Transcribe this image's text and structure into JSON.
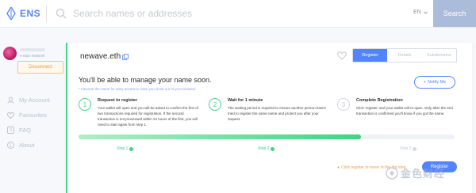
{
  "header": {
    "logo_text": "ENS",
    "search_placeholder": "Search names or addresses",
    "language": "EN",
    "search_button": "Search"
  },
  "sidebar": {
    "network": "Main Network",
    "disconnect_label": "Disconnect",
    "items": [
      {
        "label": "My Account",
        "icon": "user-icon"
      },
      {
        "label": "Favourites",
        "icon": "heart-icon"
      },
      {
        "label": "FAQ",
        "icon": "question-icon"
      },
      {
        "label": "About",
        "icon": "info-icon"
      }
    ]
  },
  "main": {
    "domain": "newave.eth",
    "tabs": [
      {
        "label": "Register",
        "active": true
      },
      {
        "label": "Details",
        "active": false
      },
      {
        "label": "Subdomains",
        "active": false
      }
    ],
    "headline": "You'll be able to manage your name soon.",
    "subnote": "* Favorite the name for easy access in case you close out of your browser.",
    "notify_label": "Notify Me",
    "steps": [
      {
        "number": "1",
        "title": "Request to register",
        "description": "Your wallet will open and you will be asked to confirm the first of two transactions required for registration. If the second transaction is not processed within 24 hours of the first, you will need to start again from step 1.",
        "label": "Step 1",
        "complete": true
      },
      {
        "number": "2",
        "title": "Wait for 1 minute",
        "description": "The waiting period is required to ensure another person hasn't tried to register the same name and protect you after your request.",
        "label": "Step 2",
        "complete": true
      },
      {
        "number": "3",
        "title": "Complete Registration",
        "description": "Click 'register' and your wallet will re-open. Only after the 2nd transaction is confirmed you'll know if you got the name.",
        "label": "Step 3",
        "complete": false
      }
    ],
    "progress_fraction": 0.75,
    "hint": "Click register to move to the 3rd step",
    "register_label": "Register"
  },
  "watermark": {
    "text": "金色财经"
  },
  "colors": {
    "accent": "#5284ff",
    "success": "#40d484",
    "warning": "#f0a04a",
    "search_button": "#aabcd9"
  }
}
